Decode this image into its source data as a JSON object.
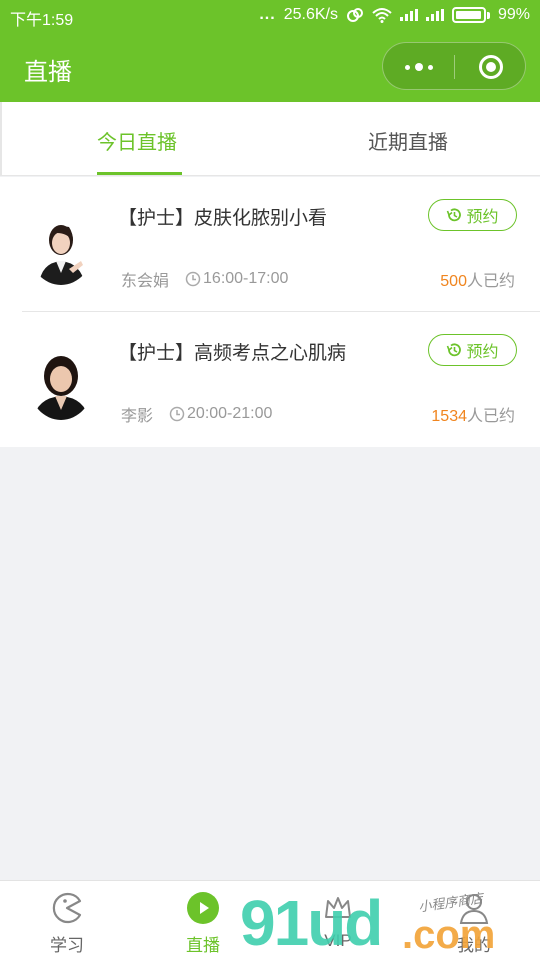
{
  "status_bar": {
    "time": "下午1:59",
    "dots": "...",
    "speed": "25.6K/s",
    "battery": "99%"
  },
  "header": {
    "title": "直播"
  },
  "tabs": [
    {
      "label": "今日直播",
      "active": true
    },
    {
      "label": "近期直播",
      "active": false
    }
  ],
  "live_list": [
    {
      "title": "【护士】皮肤化脓别小看",
      "teacher": "东会娟",
      "time": "16:00-17:00",
      "booked_count": "500",
      "booked_suffix": "人已约",
      "reserve_label": "预约"
    },
    {
      "title": "【护士】高频考点之心肌病",
      "teacher": "李影",
      "time": "20:00-21:00",
      "booked_count": "1534",
      "booked_suffix": "人已约",
      "reserve_label": "预约"
    }
  ],
  "bottom_nav": [
    {
      "label": "学习",
      "icon": "pacman-icon",
      "active": false
    },
    {
      "label": "直播",
      "icon": "play-circle-icon",
      "active": true
    },
    {
      "label": "VIP",
      "icon": "crown-icon",
      "active": false
    },
    {
      "label": "我的",
      "icon": "user-icon",
      "active": false
    }
  ],
  "watermark": {
    "main": "91ud",
    "com": ".com",
    "sub": "小程序商店"
  },
  "colors": {
    "brand_green": "#6cc32a",
    "count_orange": "#f0851f",
    "page_bg": "#f1f2f4"
  }
}
